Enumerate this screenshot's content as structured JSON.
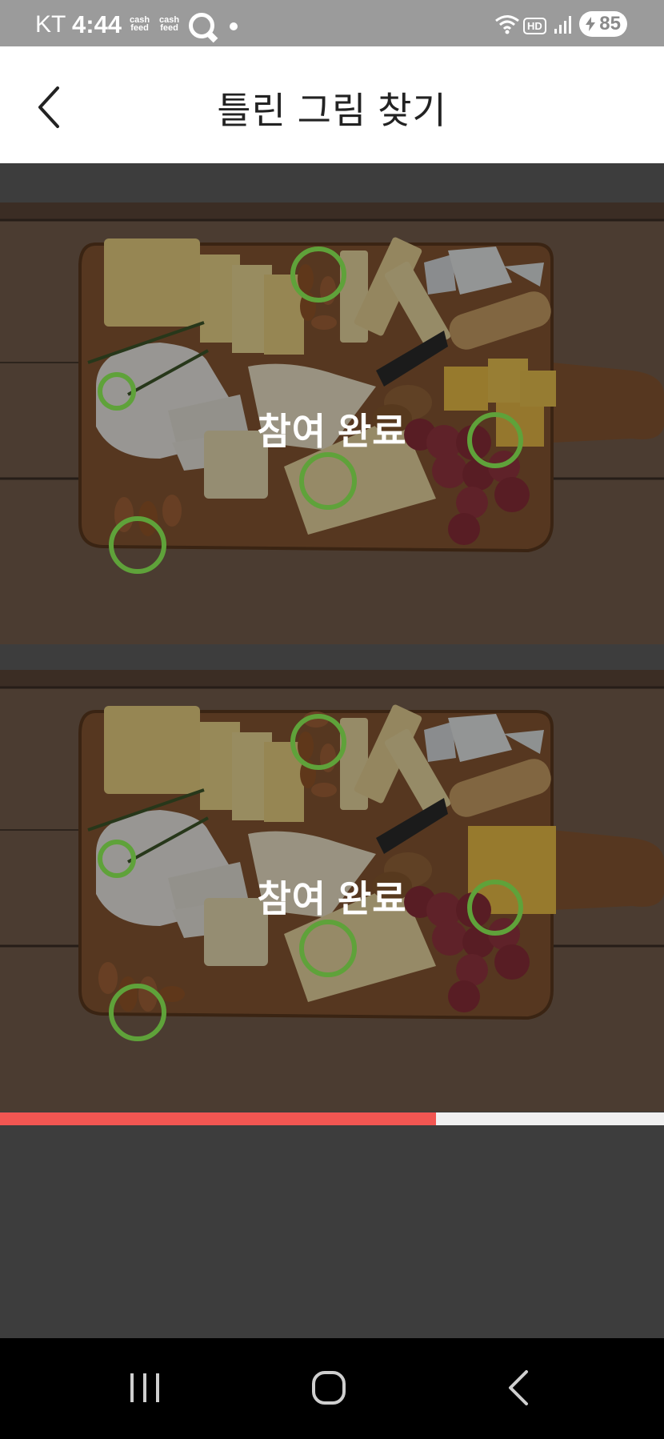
{
  "status_bar": {
    "carrier": "KT",
    "time": "4:44",
    "cash_app_1": "cash feed",
    "cash_app_2": "cash feed",
    "network_badge": "HD",
    "battery": "85",
    "icons": [
      "q-app-icon",
      "notification-dot-icon",
      "wifi-icon",
      "hd-icon",
      "signal-icon",
      "battery-charging-icon"
    ]
  },
  "header": {
    "back_icon": "chevron-left-icon",
    "title": "틀린 그림 찾기"
  },
  "game": {
    "panels": [
      {
        "name": "original-image",
        "status_label": "참여 완료"
      },
      {
        "name": "modified-image",
        "status_label": "참여 완료"
      }
    ],
    "found_count": 5,
    "progress_fraction": 0.657,
    "colors": {
      "found_circle": "#5fa23a",
      "progress_fill": "#f25652",
      "progress_track": "#f0f0f0",
      "background": "#3d3d3d"
    }
  },
  "navbar": {
    "icons": [
      "recent-apps-icon",
      "home-icon",
      "back-icon"
    ]
  }
}
